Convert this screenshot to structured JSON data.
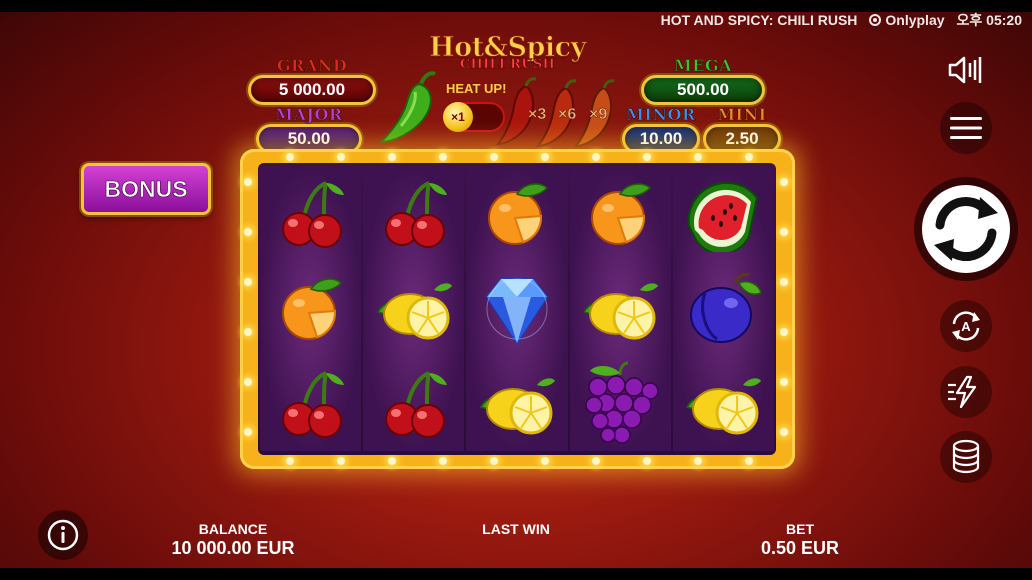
{
  "system": {
    "game_title": "HOT AND SPICY: CHILI RUSH",
    "provider": "Onlyplay",
    "time": "오후 05:20"
  },
  "logo": {
    "main": "Hot&Spicy",
    "sub": "CHILI RUSH"
  },
  "jackpots": {
    "grand": {
      "label": "GRAND",
      "value": "5 000.00"
    },
    "major": {
      "label": "MAJOR",
      "value": "50.00"
    },
    "mega": {
      "label": "MEGA",
      "value": "500.00"
    },
    "minor": {
      "label": "MINOR",
      "value": "10.00"
    },
    "mini": {
      "label": "MINI",
      "value": "2.50"
    }
  },
  "heat": {
    "label": "HEAT UP!",
    "current": "×1",
    "multipliers": [
      "×3",
      "×6",
      "×9"
    ]
  },
  "bonus_label": "BONUS",
  "reels": [
    [
      "cherry",
      "orange",
      "cherry"
    ],
    [
      "cherry",
      "lemon",
      "cherry"
    ],
    [
      "orange",
      "diamond",
      "lemon"
    ],
    [
      "orange",
      "lemon",
      "grapes"
    ],
    [
      "watermelon",
      "plum",
      "lemon"
    ]
  ],
  "bottom": {
    "balance_label": "BALANCE",
    "balance_value": "10 000.00 EUR",
    "last_win_label": "LAST WIN",
    "bet_label": "BET",
    "bet_value": "0.50 EUR"
  },
  "controls": [
    "sound-icon",
    "menu-icon",
    "spin-icon",
    "autoplay-icon",
    "turbo-icon",
    "bet-coins-icon",
    "info-icon"
  ],
  "colors": {
    "frame_gold": "#f7b21b",
    "reel_purple": "#3e1250",
    "background_red": "#9a1a10"
  }
}
